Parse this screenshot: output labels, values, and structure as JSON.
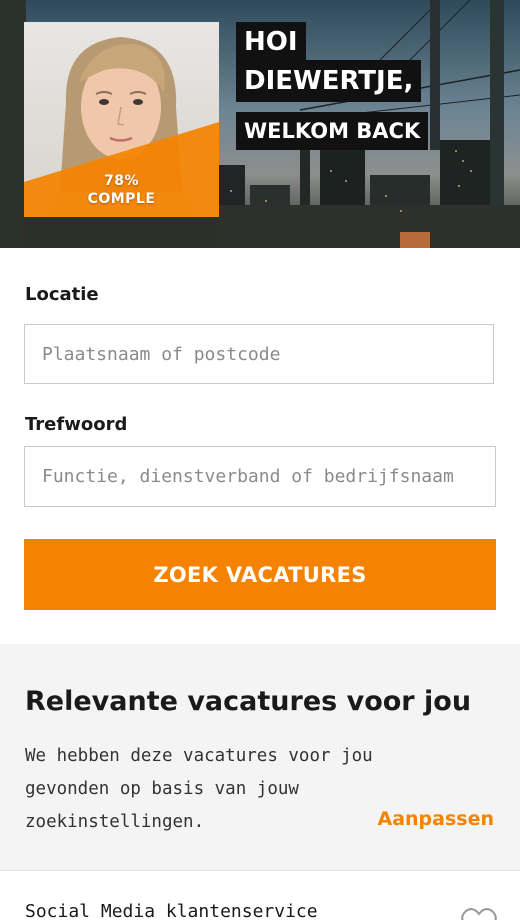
{
  "hero": {
    "completion_percent": "78%",
    "completion_label": "COMPLE",
    "greeting_line1": "HOI",
    "greeting_line2": "DIEWERTJE,",
    "greeting_line3": "WELKOM BACK"
  },
  "search_form": {
    "location_label": "Locatie",
    "location_placeholder": "Plaatsnaam of postcode",
    "keyword_label": "Trefwoord",
    "keyword_placeholder": "Functie, dienstverband of bedrijfsnaam",
    "submit_label": "ZOEK VACATURES"
  },
  "relevant": {
    "title": "Relevante vacatures voor jou",
    "description": "We hebben deze vacatures voor jou gevonden op basis van jouw zoekinstellingen.",
    "adjust_link": "Aanpassen"
  },
  "jobs": [
    {
      "title": "Social Media klantenservice",
      "favorite_icon": "heart-icon"
    }
  ],
  "colors": {
    "accent": "#f58200",
    "dark": "#111111",
    "section_bg": "#f4f4f4"
  }
}
